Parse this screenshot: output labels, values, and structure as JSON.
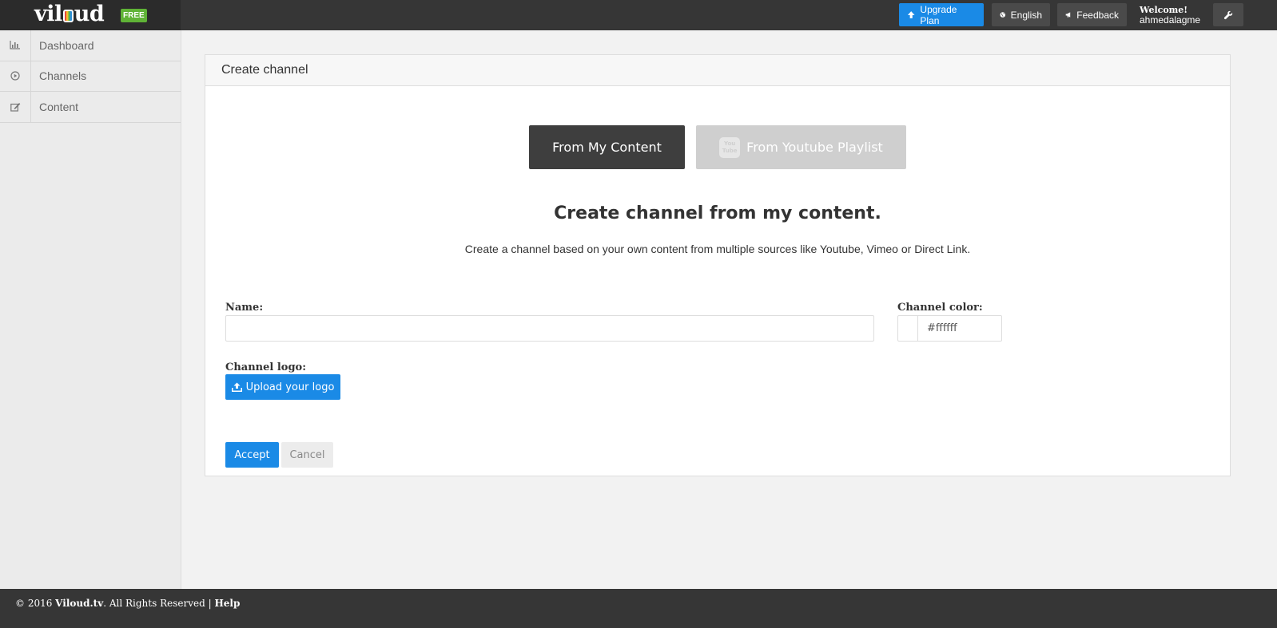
{
  "brand": {
    "logo_pre": "vil",
    "logo_post": "ud",
    "badge": "FREE"
  },
  "topbar": {
    "upgrade_label": "Upgrade Plan",
    "language_label": "English",
    "feedback_label": "Feedback",
    "welcome_label": "Welcome!",
    "username": "ahmedalagme"
  },
  "sidebar": {
    "items": [
      {
        "label": "Dashboard",
        "icon": "bar-chart-icon"
      },
      {
        "label": "Channels",
        "icon": "play-circle-icon"
      },
      {
        "label": "Content",
        "icon": "edit-icon"
      }
    ]
  },
  "panel": {
    "title": "Create channel",
    "source_tabs": {
      "mine": "From My Content",
      "youtube": "From Youtube Playlist",
      "youtube_logo_top": "You",
      "youtube_logo_bottom": "Tube"
    },
    "heading": "Create channel from my content.",
    "description": "Create a channel based on your own content from multiple sources like Youtube, Vimeo or Direct Link.",
    "form": {
      "name_label": "Name:",
      "name_value": "",
      "color_label": "Channel color:",
      "color_value": "#ffffff",
      "logo_label": "Channel logo:",
      "upload_label": "Upload your logo",
      "accept_label": "Accept",
      "cancel_label": "Cancel"
    }
  },
  "footer": {
    "copyright": "© 2016 ",
    "site": "Viloud.tv",
    "rights": ". All Rights Reserved | ",
    "help": "Help"
  },
  "colors": {
    "accent": "#1a8ae6",
    "dark": "#363636",
    "free_badge": "#5fb336"
  }
}
